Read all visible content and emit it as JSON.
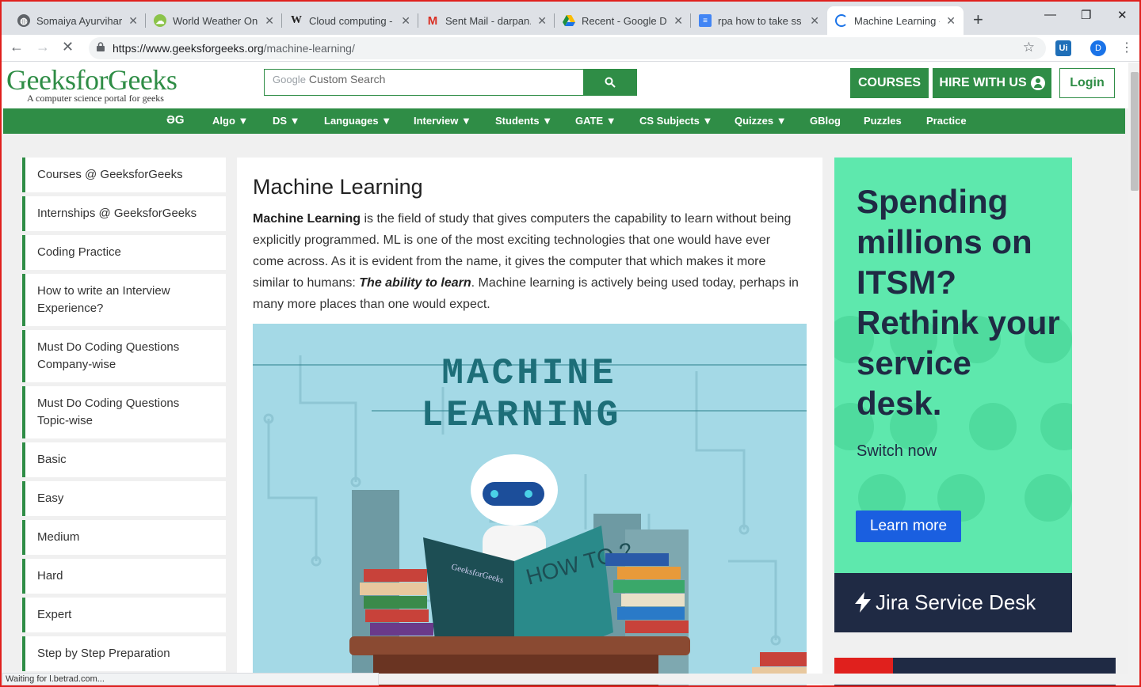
{
  "tabs": [
    {
      "label": "Somaiya Ayurvihar",
      "icon": "globe-icon"
    },
    {
      "label": "World Weather Onlin",
      "icon": "weather-icon"
    },
    {
      "label": "Cloud computing - W",
      "icon": "wikipedia-icon"
    },
    {
      "label": "Sent Mail - darpan.c",
      "icon": "gmail-icon"
    },
    {
      "label": "Recent - Google Driv",
      "icon": "drive-icon"
    },
    {
      "label": "rpa how to take ss -",
      "icon": "docs-icon"
    },
    {
      "label": "Machine Learning - G",
      "icon": "loading-icon"
    }
  ],
  "address": {
    "host": "https://www.geeksforgeeks.org",
    "path": "/machine-learning/"
  },
  "extension_label": "Ui",
  "avatar_letter": "D",
  "logo": {
    "name": "GeeksforGeeks",
    "tagline": "A computer science portal for geeks"
  },
  "search": {
    "brand": "Google",
    "placeholder": "Custom Search"
  },
  "header_buttons": {
    "courses": "COURSES",
    "hire": "HIRE WITH US",
    "login": "Login"
  },
  "nav": [
    {
      "label": "ƏG"
    },
    {
      "label": "Algo ▼"
    },
    {
      "label": "DS ▼"
    },
    {
      "label": "Languages ▼"
    },
    {
      "label": "Interview ▼"
    },
    {
      "label": "Students ▼"
    },
    {
      "label": "GATE ▼"
    },
    {
      "label": "CS Subjects ▼"
    },
    {
      "label": "Quizzes ▼"
    },
    {
      "label": "GBlog"
    },
    {
      "label": "Puzzles"
    },
    {
      "label": "Practice"
    }
  ],
  "sidebar": [
    "Courses @ GeeksforGeeks",
    "Internships @ GeeksforGeeks",
    "Coding Practice",
    "How to write an Interview Experience?",
    "Must Do Coding Questions Company-wise",
    "Must Do Coding Questions Topic-wise",
    "Basic",
    "Easy",
    "Medium",
    "Hard",
    "Expert",
    "Step by Step Preparation"
  ],
  "article": {
    "title": "Machine Learning",
    "intro_bold": "Machine Learning",
    "intro_1": " is the field of study that gives computers the capability to learn without being explicitly programmed. ML is one of the most exciting technologies that one would have ever come across. As it is evident from the name, it gives the computer that which makes it more similar to humans: ",
    "intro_em": "The ability to learn",
    "intro_2": ". Machine learning is actively being used today, perhaps in many more places than one would expect.",
    "image_title_1": "MACHINE",
    "image_title_2": "LEARNING",
    "book_text": "HOW TO ?",
    "book_brand": "GeeksforGeeks"
  },
  "ad": {
    "headline": "Spending millions on ITSM? Rethink your service desk.",
    "switch": "Switch now",
    "cta": "Learn more",
    "brand": "Jira Service Desk"
  },
  "status_text": "Waiting for l.betrad.com..."
}
